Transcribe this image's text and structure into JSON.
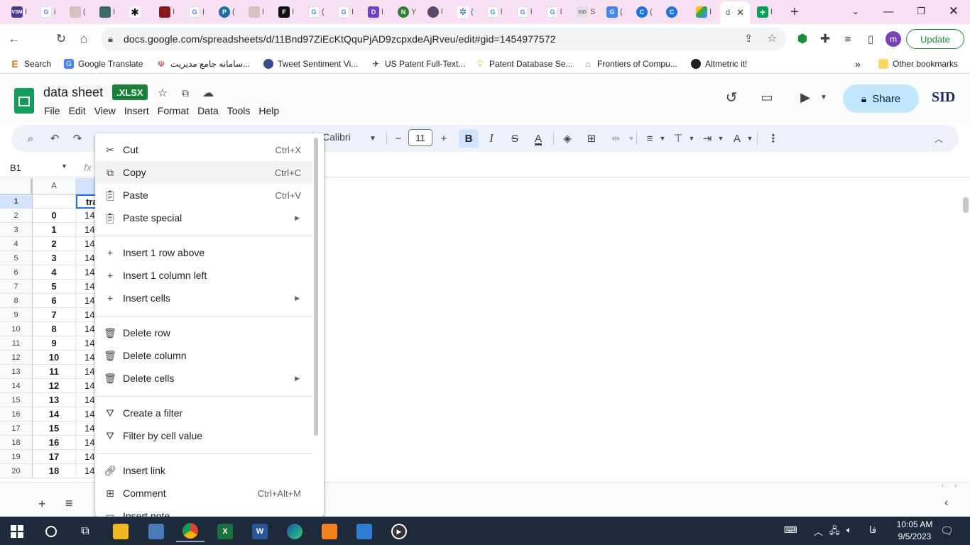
{
  "browser": {
    "tabs": [
      {
        "icon": "vsm-icon",
        "letter": "VSM",
        "color": "#4a3b8c",
        "title": "I"
      },
      {
        "icon": "google-icon",
        "letter": "G",
        "color": "#ffffff",
        "title": "i"
      },
      {
        "icon": "page-icon",
        "letter": "",
        "color": "#d8c0c0",
        "title": "("
      },
      {
        "icon": "app-icon",
        "letter": "",
        "color": "#3d6b6b",
        "title": "I"
      },
      {
        "icon": "asterisk-icon",
        "letter": "✱",
        "color": "#111111",
        "title": ""
      },
      {
        "icon": "book-icon",
        "letter": "",
        "color": "#8b1a1a",
        "title": "I"
      },
      {
        "icon": "google-icon",
        "letter": "G",
        "color": "#ffffff",
        "title": "I"
      },
      {
        "icon": "p-icon",
        "letter": "P",
        "color": "#1b6fa8",
        "title": "("
      },
      {
        "icon": "page-icon",
        "letter": "",
        "color": "#d8c0c0",
        "title": "I"
      },
      {
        "icon": "f-icon",
        "letter": "F",
        "color": "#111111",
        "title": "I"
      },
      {
        "icon": "google-icon",
        "letter": "G",
        "color": "#ffffff",
        "title": "("
      },
      {
        "icon": "google-icon",
        "letter": "G",
        "color": "#ffffff",
        "title": "I"
      },
      {
        "icon": "d-icon",
        "letter": "D",
        "color": "#6b3fd1",
        "title": "I"
      },
      {
        "icon": "n-icon",
        "letter": "N",
        "color": "#2e7d32",
        "title": "Y"
      },
      {
        "icon": "avatar-icon",
        "letter": "",
        "color": "#5a4a6a",
        "title": "l"
      },
      {
        "icon": "star-icon",
        "letter": "",
        "color": "#2d6fb5",
        "title": "("
      },
      {
        "icon": "google-icon",
        "letter": "G",
        "color": "#ffffff",
        "title": "l"
      },
      {
        "icon": "google-icon",
        "letter": "G",
        "color": "#ffffff",
        "title": "l"
      },
      {
        "icon": "google-icon",
        "letter": "G",
        "color": "#ffffff",
        "title": "l"
      },
      {
        "icon": "sid-icon",
        "letter": "SID",
        "color": "#e0e0e0",
        "title": "S"
      },
      {
        "icon": "translate-icon",
        "letter": "G",
        "color": "#4285f4",
        "title": "("
      },
      {
        "icon": "c-icon",
        "letter": "C",
        "color": "#1a73e8",
        "title": "("
      },
      {
        "icon": "c-icon",
        "letter": "C",
        "color": "#1a73e8",
        "title": ""
      },
      {
        "icon": "drive-icon",
        "letter": "",
        "color": "#fbbc04",
        "title": "I"
      },
      {
        "icon": "sheets-icon",
        "letter": "",
        "color": "#ffffff",
        "title": "d"
      },
      {
        "icon": "sheets-add-icon",
        "letter": "+",
        "color": "#0f9d58",
        "title": "I"
      }
    ],
    "url": "docs.google.com/spreadsheets/d/11Bnd97ZiEcKtQquPjAD9zcpxdeAjRveu/edit#gid=1454977572",
    "update_label": "Update",
    "profile_letter": "m",
    "bookmarks": [
      {
        "label": "Search",
        "icon": "e-icon",
        "color": "#e8710a"
      },
      {
        "label": "Google Translate",
        "icon": "translate-icon",
        "color": "#4285f4"
      },
      {
        "label": "سامانه جامع مدیریت...",
        "icon": "emblem-icon",
        "color": "#b71c1c"
      },
      {
        "label": "Tweet Sentiment Vi...",
        "icon": "globe-icon",
        "color": "#3c4a8a"
      },
      {
        "label": "US Patent Full-Text...",
        "icon": "uspto-icon",
        "color": "#333333"
      },
      {
        "label": "Patent Database Se...",
        "icon": "bulb-icon",
        "color": "#f9ab00"
      },
      {
        "label": "Frontiers of Compu...",
        "icon": "frontiers-icon",
        "color": "#888888"
      },
      {
        "label": "Altmetric it!",
        "icon": "altmetric-icon",
        "color": "#222222"
      }
    ],
    "other_bookmarks": "Other bookmarks",
    "more_bookmarks": "»"
  },
  "sheets": {
    "title": ".XLSX",
    "doc_name": "data sheet",
    "menus": [
      "File",
      "Edit",
      "View",
      "Insert",
      "Format",
      "Data",
      "Tools",
      "Help"
    ],
    "share_label": "Share",
    "brand": "SID",
    "font_name": "Calibri",
    "font_size": "11",
    "name_box": "B1",
    "fx": "fx"
  },
  "grid": {
    "columns": [
      "A"
    ],
    "rows": [
      {
        "num": "1",
        "a": "",
        "b": "tra"
      },
      {
        "num": "2",
        "a": "0",
        "b": "14"
      },
      {
        "num": "3",
        "a": "1",
        "b": "14"
      },
      {
        "num": "4",
        "a": "2",
        "b": "14"
      },
      {
        "num": "5",
        "a": "3",
        "b": "14"
      },
      {
        "num": "6",
        "a": "4",
        "b": "14"
      },
      {
        "num": "7",
        "a": "5",
        "b": "14"
      },
      {
        "num": "8",
        "a": "6",
        "b": "14"
      },
      {
        "num": "9",
        "a": "7",
        "b": "14"
      },
      {
        "num": "10",
        "a": "8",
        "b": "14"
      },
      {
        "num": "11",
        "a": "9",
        "b": "14"
      },
      {
        "num": "12",
        "a": "10",
        "b": "14"
      },
      {
        "num": "13",
        "a": "11",
        "b": "14"
      },
      {
        "num": "14",
        "a": "12",
        "b": "14"
      },
      {
        "num": "15",
        "a": "13",
        "b": "14"
      },
      {
        "num": "16",
        "a": "14",
        "b": "14"
      },
      {
        "num": "17",
        "a": "15",
        "b": "14"
      },
      {
        "num": "18",
        "a": "16",
        "b": "14"
      },
      {
        "num": "19",
        "a": "17",
        "b": "14"
      },
      {
        "num": "20",
        "a": "18",
        "b": "14"
      }
    ]
  },
  "context_menu": {
    "cut": {
      "label": "Cut",
      "shortcut": "Ctrl+X"
    },
    "copy": {
      "label": "Copy",
      "shortcut": "Ctrl+C"
    },
    "paste": {
      "label": "Paste",
      "shortcut": "Ctrl+V"
    },
    "paste_special": {
      "label": "Paste special"
    },
    "insert_row": {
      "label": "Insert 1 row above"
    },
    "insert_col": {
      "label": "Insert 1 column left"
    },
    "insert_cells": {
      "label": "Insert cells"
    },
    "delete_row": {
      "label": "Delete row"
    },
    "delete_col": {
      "label": "Delete column"
    },
    "delete_cells": {
      "label": "Delete cells"
    },
    "create_filter": {
      "label": "Create a filter"
    },
    "filter_by_value": {
      "label": "Filter by cell value"
    },
    "insert_link": {
      "label": "Insert link"
    },
    "comment": {
      "label": "Comment",
      "shortcut": "Ctrl+Alt+M"
    },
    "insert_note": {
      "label": "Insert note"
    }
  },
  "taskbar": {
    "time": "10:05 AM",
    "date": "9/5/2023",
    "lang": "فا"
  }
}
